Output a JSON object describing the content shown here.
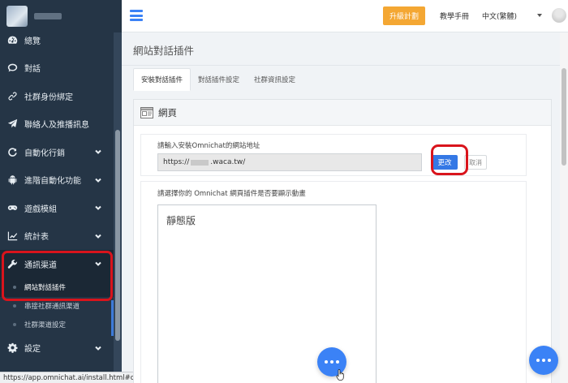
{
  "sidebar": {
    "items": [
      {
        "label": "總覽",
        "icon": "dashboard-icon",
        "has_children": false
      },
      {
        "label": "對話",
        "icon": "chat-icon",
        "has_children": false
      },
      {
        "label": "社群身份綁定",
        "icon": "link-icon",
        "has_children": false
      },
      {
        "label": "聯絡人及推播訊息",
        "icon": "send-icon",
        "has_children": false
      },
      {
        "label": "自動化行銷",
        "icon": "refresh-icon",
        "has_children": true
      },
      {
        "label": "進階自動化功能",
        "icon": "android-icon",
        "has_children": true
      },
      {
        "label": "遊戲模組",
        "icon": "gamepad-icon",
        "has_children": true
      },
      {
        "label": "統計表",
        "icon": "chart-icon",
        "has_children": true
      },
      {
        "label": "通訊渠道",
        "icon": "wrench-icon",
        "has_children": true,
        "expanded": true
      }
    ],
    "sub_items": [
      "網站對話插件",
      "串接社群通訊渠道",
      "社群渠道設定"
    ],
    "settings": {
      "label": "設定",
      "icon": "gear-icon"
    }
  },
  "status_url": "https://app.omnichat.ai/install.html#collapseOne",
  "topbar": {
    "upgrade_label": "升級計劃",
    "manual_label": "教學手冊",
    "language_label": "中文(繁體)"
  },
  "main": {
    "page_title": "網站對話插件",
    "tabs": [
      "安裝對話插件",
      "對話插件設定",
      "社群資訊設定"
    ],
    "active_tab": 0,
    "panel_title": "網頁",
    "url_prompt": "請輸入安裝Omnichat的網站地址",
    "url_prefix": "https://",
    "url_suffix": ".waca.tw/",
    "change_label": "更改",
    "cancel_label": "取消",
    "animation_prompt": "請選擇你的 Omnichat 網頁插件是否要顯示動畫",
    "static_label": "靜態版"
  },
  "colors": {
    "sidebar_bg": "#253546",
    "accent": "#3b82f6",
    "upgrade": "#f4a733",
    "highlight": "#d9141c"
  }
}
